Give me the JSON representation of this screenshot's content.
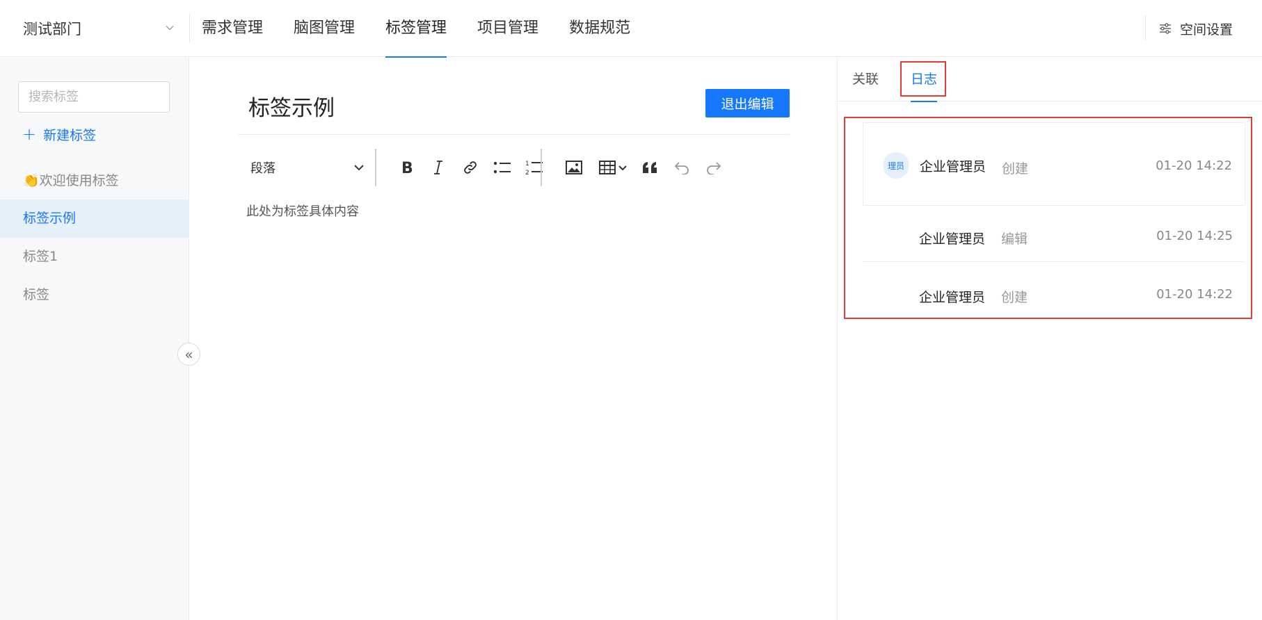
{
  "header": {
    "department": "测试部门",
    "nav_tabs": [
      {
        "label": "需求管理",
        "active": false
      },
      {
        "label": "脑图管理",
        "active": false
      },
      {
        "label": "标签管理",
        "active": true
      },
      {
        "label": "项目管理",
        "active": false
      },
      {
        "label": "数据规范",
        "active": false
      }
    ],
    "space_settings_label": "空间设置",
    "space_settings_icon": "sliders-icon"
  },
  "sidebar": {
    "search_placeholder": "搜索标签",
    "new_tag_label": "新建标签",
    "items": [
      {
        "label": "👏欢迎使用标签",
        "active": false
      },
      {
        "label": "标签示例",
        "active": true
      },
      {
        "label": "标签1",
        "active": false
      },
      {
        "label": "标签",
        "active": false
      }
    ],
    "collapse_icon": "double-chevron-left-icon"
  },
  "editor": {
    "title": "标签示例",
    "exit_button": "退出编辑",
    "paragraph_select": "段落",
    "content": "此处为标签具体内容",
    "toolbar_icons": [
      "bold-icon",
      "italic-icon",
      "link-icon",
      "bulleted-list-icon",
      "numbered-list-icon",
      "image-icon",
      "table-icon",
      "quote-icon",
      "undo-icon",
      "redo-icon"
    ]
  },
  "right_panel": {
    "tabs": [
      {
        "label": "关联",
        "active": false
      },
      {
        "label": "日志",
        "active": true
      }
    ],
    "logs": [
      {
        "avatar": "理员",
        "user": "企业管理员",
        "action": "创建",
        "time": "01-20 14:22"
      },
      {
        "user": "企业管理员",
        "action": "编辑",
        "time": "01-20 14:25"
      },
      {
        "user": "企业管理员",
        "action": "创建",
        "time": "01-20 14:22"
      }
    ]
  },
  "colors": {
    "accent": "#1677ff",
    "highlight_box": "#e53935",
    "active_row_bg": "#e6f0fb"
  }
}
